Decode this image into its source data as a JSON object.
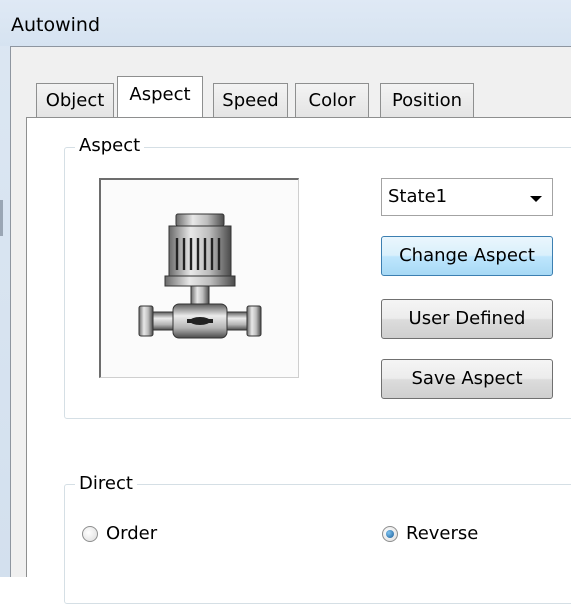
{
  "window": {
    "title": "Autowind"
  },
  "tabs": [
    {
      "label": "Object"
    },
    {
      "label": "Aspect",
      "active": true
    },
    {
      "label": "Speed"
    },
    {
      "label": "Color"
    },
    {
      "label": "Position"
    }
  ],
  "aspect_group": {
    "label": "Aspect",
    "preview_icon": "pump-icon",
    "state_select": {
      "value": "State1"
    },
    "buttons": {
      "change": "Change Aspect",
      "user_defined": "User Defined",
      "save": "Save Aspect"
    }
  },
  "direct_group": {
    "label": "Direct",
    "options": [
      {
        "label": "Order",
        "checked": false
      },
      {
        "label": "Reverse",
        "checked": true
      }
    ]
  }
}
